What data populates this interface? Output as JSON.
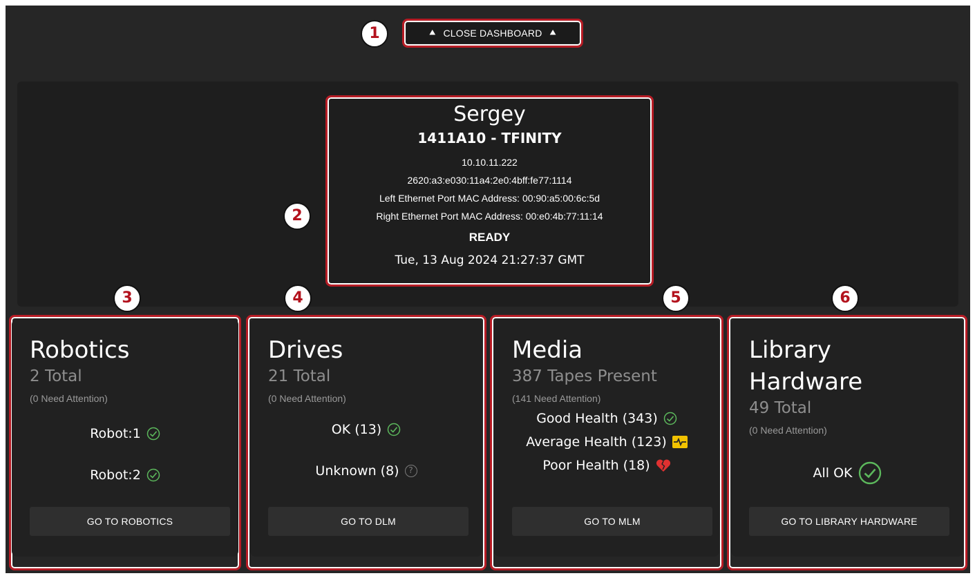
{
  "header": {
    "close_label": "CLOSE DASHBOARD"
  },
  "callouts": [
    "1",
    "2",
    "3",
    "4",
    "5",
    "6"
  ],
  "library": {
    "name": "Sergey",
    "model": "1411A10 - TFINITY",
    "ipv4": "10.10.11.222",
    "ipv6": "2620:a3:e030:11a4:2e0:4bff:fe77:1114",
    "left_mac": "Left Ethernet Port MAC Address: 00:90:a5:00:6c:5d",
    "right_mac": "Right Ethernet Port MAC Address: 00:e0:4b:77:11:14",
    "status": "READY",
    "timestamp": "Tue, 13 Aug 2024 21:27:37 GMT"
  },
  "cards": {
    "robotics": {
      "title": "Robotics",
      "total": "2 Total",
      "attention": "(0 Need Attention)",
      "rows": [
        "Robot:1",
        "Robot:2"
      ],
      "button": "GO TO ROBOTICS"
    },
    "drives": {
      "title": "Drives",
      "total": "21 Total",
      "attention": "(0 Need Attention)",
      "rows": [
        "OK (13)",
        "Unknown (8)"
      ],
      "button": "GO TO DLM"
    },
    "media": {
      "title": "Media",
      "total": "387 Tapes Present",
      "attention": "(141 Need Attention)",
      "rows": [
        "Good Health (343)",
        "Average Health (123)",
        "Poor Health (18)"
      ],
      "button": "GO TO MLM"
    },
    "hardware": {
      "title_line1": "Library",
      "title_line2": "Hardware",
      "total": "49 Total",
      "attention": "(0 Need Attention)",
      "rows": [
        "All OK"
      ],
      "button": "GO TO LIBRARY HARDWARE"
    }
  },
  "colors": {
    "ok_green": "#5cb85c",
    "warning_yellow": "#f2c200",
    "error_red": "#e03131",
    "highlight_red": "#b71c25",
    "callout_text": "#b3121d"
  }
}
